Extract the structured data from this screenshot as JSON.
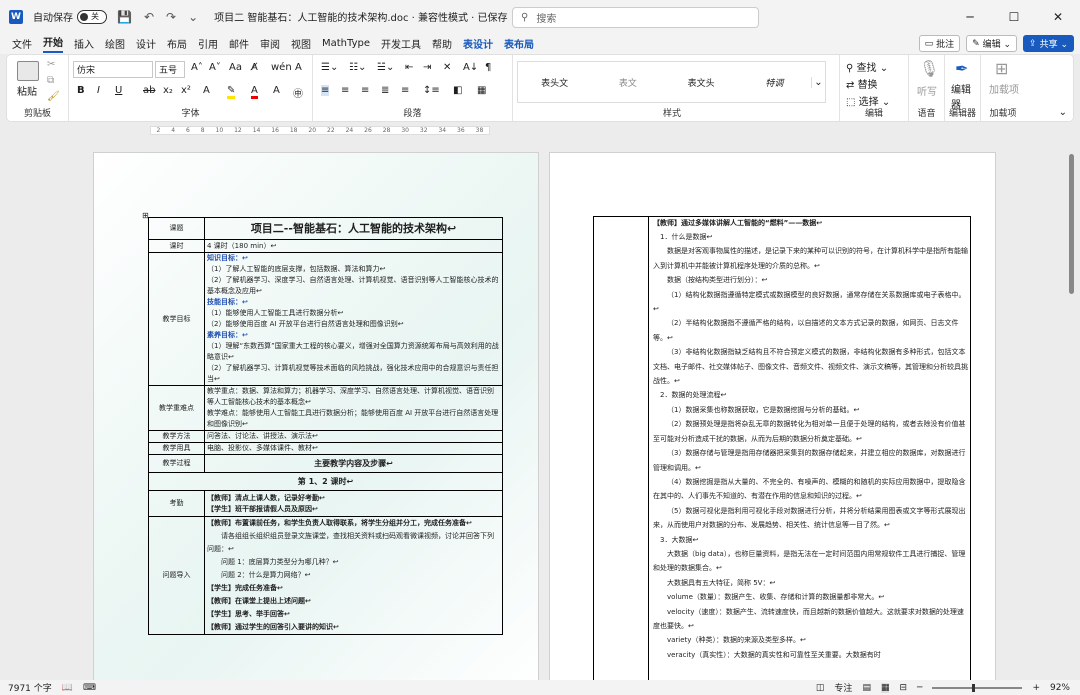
{
  "titlebar": {
    "logo": "W",
    "autosave": "自动保存",
    "toggle": "关",
    "save_icon": "💾",
    "undo": "↶",
    "redo": "↷",
    "more": "⌄",
    "title": "项目二 智能基石：人工智能的技术架构.doc · 兼容性模式 · 已保存 ⌄",
    "search_placeholder": "搜索",
    "minimize": "─",
    "restore": "☐",
    "close": "✕"
  },
  "menu": {
    "tabs": [
      "文件",
      "开始",
      "插入",
      "绘图",
      "设计",
      "布局",
      "引用",
      "邮件",
      "审阅",
      "视图",
      "MathType",
      "开发工具",
      "帮助",
      "表设计",
      "表布局"
    ],
    "comment": "批注",
    "edit": "编辑 ⌄",
    "share": "共享 ⌄"
  },
  "ribbon": {
    "paste": "粘贴",
    "clipboard": "剪贴板",
    "font_name": "仿宋",
    "font_size": "五号",
    "font": "字体",
    "paragraph": "段落",
    "styles": [
      "表头文",
      "表文",
      "表文头",
      "特调"
    ],
    "style_label": "样式",
    "find": "查找 ⌄",
    "replace": "替换",
    "select": "选择 ⌄",
    "edit_label": "编辑",
    "listen": "听写",
    "voice": "语音",
    "editor": "编辑器",
    "editor2": "编辑器",
    "addins": "加载项",
    "addins_btn": "加载项"
  },
  "ruler": {
    "ticks": [
      "2",
      "4",
      "6",
      "8",
      "10",
      "12",
      "14",
      "16",
      "18",
      "20",
      "22",
      "24",
      "26",
      "28",
      "30",
      "32",
      "34",
      "36",
      "38"
    ]
  },
  "page1": {
    "rows": [
      {
        "k": "课题",
        "v": "项目二--智能基石：人工智能的技术架构↩"
      },
      {
        "k": "课时",
        "v": "4 课时（180 min）↩"
      },
      {
        "k": "教学目标",
        "lines": [
          "知识目标：↩",
          "（1）了解人工智能的底层支撑，包括数据、算法和算力↩",
          "（2）了解机器学习、深度学习、自然语言处理、计算机视觉、语音识别等人工智能核心技术的基本概念及应用↩",
          "技能目标：↩",
          "（1）能够使用人工智能工具进行数据分析↩",
          "（2）能够使用百度 AI 开放平台进行自然语言处理和图像识别↩",
          "素养目标：↩",
          "（1）理解“东数西算”国家重大工程的核心要义，增强对全国算力资源统筹布局与高效利用的战略意识↩",
          "（2）了解机器学习、计算机视觉等技术面临的风险挑战，强化技术应用中的合规意识与责任担当↩"
        ]
      },
      {
        "k": "教学重难点",
        "lines": [
          "教学重点：数据、算法和算力；机器学习、深度学习、自然语言处理、计算机视觉、语音识别等人工智能核心技术的基本概念↩",
          "教学难点：能够使用人工智能工具进行数据分析；能够使用百度 AI 开放平台进行自然语言处理和图像识别↩"
        ]
      },
      {
        "k": "教学方法",
        "v": "问答法、讨论法、讲授法、演示法↩"
      },
      {
        "k": "教学用具",
        "v": "电脑、投影仪、多媒体课件、教材↩"
      },
      {
        "k": "教学过程",
        "v": "主要教学内容及步骤↩"
      },
      {
        "k": "",
        "v": "第 1、2 课时↩"
      },
      {
        "k": "考勤",
        "lines": [
          "【教师】清点上课人数，记录好考勤↩",
          "【学生】班干部报请假人员及原因↩"
        ]
      },
      {
        "k": "问题导入",
        "lines": [
          "【教师】布置课前任务，和学生负责人取得联系，将学生分组并分工，完成任务准备↩",
          "请各组组长组织组员登录文旌课堂，查找相关资料或扫码观看微课视频，讨论并回答下列问题：↩",
          "问题 1：底层算力类型分为哪几种？↩",
          "问题 2：什么是算力网络？↩",
          "【学生】完成任务准备↩",
          "【教师】在课堂上提出上述问题↩",
          "【学生】思考、举手回答↩",
          "【教师】通过学生的回答引入要讲的知识↩"
        ]
      }
    ]
  },
  "page2": {
    "heading": "【教师】通过多媒体讲解人工智能的“燃料”——数据↩",
    "paras": [
      "1．什么是数据↩",
      "数据是对客观事物属性的描述，是记录下来的某种可以识别的符号，在计算机科学中是指所有能输入到计算机中并能被计算机程序处理的介质的总称。↩",
      "数据（按结构类型进行划分）：↩",
      "（1）结构化数据指遵循特定模式或数据模型的良好数据，通常存储在关系数据库或电子表格中。↩",
      "（2）半结构化数据指不遵循严格的结构，以自描述的文本方式记录的数据，如网页、日志文件等。↩",
      "（3）非结构化数据指缺乏结构且不符合预定义模式的数据，非结构化数据有多种形式，包括文本文档、电子邮件、社交媒体帖子、图像文件、音频文件、视频文件、演示文稿等，其管理和分析较具挑战性。↩",
      "2．数据的处理流程↩",
      "（1）数据采集也称数据获取，它是数据挖掘与分析的基础。↩",
      "（2）数据预处理是指将杂乱无章的数据转化为相对单一且便于处理的结构，或者去除没有价值甚至可能对分析造成干扰的数据，从而为后期的数据分析奠定基础。↩",
      "（3）数据存储与管理是指用存储器把采集到的数据存储起来，并建立相应的数据库，对数据进行管理和调用。↩",
      "（4）数据挖掘是指从大量的、不完全的、有噪声的、模糊的和随机的实际应用数据中，提取隐含在其中的、人们事先不知道的、有潜在作用的信息和知识的过程。↩",
      "（5）数据可视化是指利用可视化手段对数据进行分析，并将分析结果用图表或文字等形式展现出来，从而使用户对数据的分布、发展趋势、相关性、统计信息等一目了然。↩",
      "3．大数据↩",
      "大数据（big data），也称巨量资料，是指无法在一定时间范围内用常规软件工具进行捕捉、管理和处理的数据集合。↩",
      "大数据具有五大特征，简称 5V：↩",
      "volume（数量）：数据产生、收集、存储和计算的数据量都非常大。↩",
      "velocity（速度）：数据产生、流转速度快，而且越新的数据价值越大。这就要求对数据的处理速度也要快。↩",
      "variety（种类）：数据的来源及类型多样。↩",
      "veracity（真实性）：大数据的真实性和可靠性至关重要。大数据有时"
    ]
  },
  "status": {
    "words": "7971 个字",
    "focus": "专注",
    "zoom": "92%",
    "minus": "─",
    "plus": "+"
  }
}
